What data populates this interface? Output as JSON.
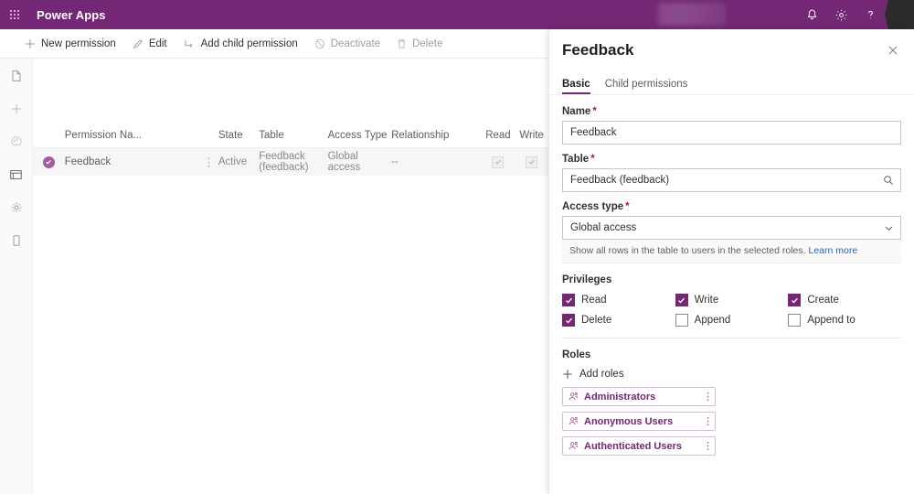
{
  "header": {
    "brand": "Power Apps",
    "waffle_icon": "waffle-grid-icon",
    "notification_icon": "bell-icon",
    "settings_icon": "gear-icon",
    "help_icon": "question-mark-icon",
    "avatar": "user-avatar"
  },
  "commandbar": {
    "items": [
      {
        "label": "New permission",
        "icon": "plus-icon",
        "disabled": false
      },
      {
        "label": "Edit",
        "icon": "pencil-icon",
        "disabled": false
      },
      {
        "label": "Add child permission",
        "icon": "add-child-icon",
        "disabled": false
      },
      {
        "label": "Deactivate",
        "icon": "block-circle-icon",
        "disabled": true
      },
      {
        "label": "Delete",
        "icon": "trash-icon",
        "disabled": true
      }
    ]
  },
  "sidebar": {
    "items": [
      {
        "name": "pages-icon"
      },
      {
        "name": "add-icon"
      },
      {
        "name": "theme-palette-icon"
      },
      {
        "name": "browser-window-icon"
      },
      {
        "name": "settings-gear-icon"
      },
      {
        "name": "mobile-preview-icon"
      }
    ]
  },
  "table": {
    "columns": [
      "Permission Na...",
      "State",
      "Table",
      "Access Type",
      "Relationship",
      "Read",
      "Write"
    ],
    "rows": [
      {
        "name": "Feedback",
        "state": "Active",
        "table": "Feedback (feedback)",
        "access_type": "Global access",
        "relationship": "--",
        "read": true,
        "write": true,
        "selected": true
      }
    ]
  },
  "panel": {
    "title": "Feedback",
    "close_icon": "close-icon",
    "tabs": [
      {
        "label": "Basic",
        "active": true
      },
      {
        "label": "Child permissions",
        "active": false
      }
    ],
    "fields": {
      "name_label": "Name",
      "name_value": "Feedback",
      "table_label": "Table",
      "table_value": "Feedback (feedback)",
      "table_icon": "search-icon",
      "access_label": "Access type",
      "access_value": "Global access",
      "access_icon": "chevron-down-icon",
      "required_marker": "*",
      "hint_text": "Show all rows in the table to users in the selected roles.",
      "hint_link": "Learn more"
    },
    "privileges": {
      "title": "Privileges",
      "items": [
        {
          "label": "Read",
          "checked": true
        },
        {
          "label": "Write",
          "checked": true
        },
        {
          "label": "Create",
          "checked": true
        },
        {
          "label": "Delete",
          "checked": true
        },
        {
          "label": "Append",
          "checked": false
        },
        {
          "label": "Append to",
          "checked": false
        }
      ]
    },
    "roles": {
      "title": "Roles",
      "add_label": "Add roles",
      "add_icon": "plus-icon",
      "items": [
        {
          "label": "Administrators",
          "icon": "people-icon",
          "menu_icon": "more-vertical-icon"
        },
        {
          "label": "Anonymous Users",
          "icon": "people-icon",
          "menu_icon": "more-vertical-icon"
        },
        {
          "label": "Authenticated Users",
          "icon": "people-icon",
          "menu_icon": "more-vertical-icon"
        }
      ]
    }
  },
  "colors": {
    "brand_purple": "#742774",
    "accent_purple": "#a15fa0",
    "required_red": "#a4262c",
    "link_blue": "#2266bb"
  }
}
